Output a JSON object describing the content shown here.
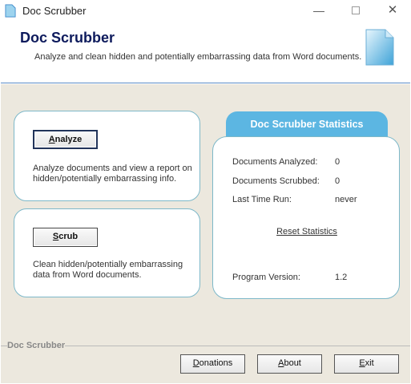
{
  "window": {
    "title": "Doc Scrubber"
  },
  "header": {
    "title": "Doc Scrubber",
    "subtitle": "Analyze and clean hidden and potentially embarrassing data from Word documents."
  },
  "analyze": {
    "button_first": "A",
    "button_rest": "nalyze",
    "description": "Analyze documents and view a report on hidden/potentially embarrassing info."
  },
  "scrub": {
    "button_first": "S",
    "button_rest": "crub",
    "description": "Clean hidden/potentially embarrassing data from Word documents."
  },
  "stats": {
    "title": "Doc Scrubber Statistics",
    "documents_analyzed_label": "Documents Analyzed:",
    "documents_analyzed_value": "0",
    "documents_scrubbed_label": "Documents Scrubbed:",
    "documents_scrubbed_value": "0",
    "last_time_run_label": "Last Time Run:",
    "last_time_run_value": "never",
    "reset_label": "Reset Statistics",
    "program_version_label": "Program Version:",
    "program_version_value": "1.2"
  },
  "footer": {
    "group_label": "Doc Scrubber",
    "donations_first": "D",
    "donations_rest": "onations",
    "about_first": "A",
    "about_rest": "bout",
    "exit_first": "E",
    "exit_rest": "xit"
  },
  "colors": {
    "accent": "#5cb6e2",
    "border": "#7db8c9",
    "background": "#ece8de",
    "title": "#0d1a5c"
  }
}
